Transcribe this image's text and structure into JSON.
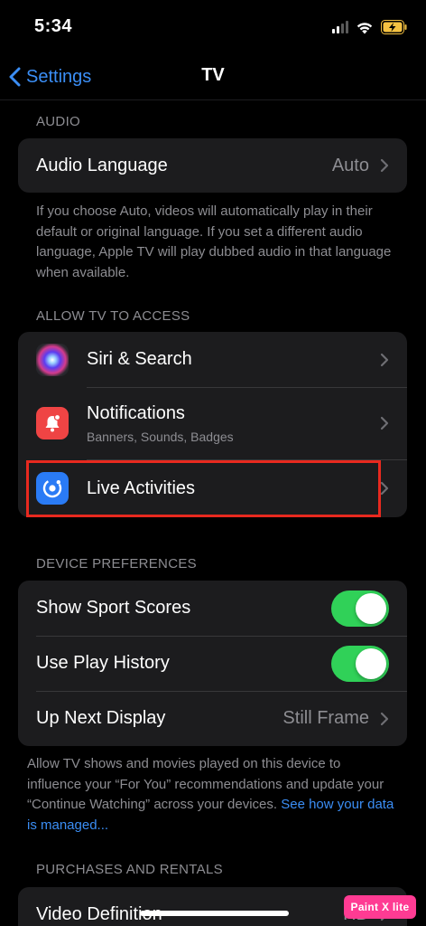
{
  "status_bar": {
    "time": "5:34"
  },
  "nav": {
    "back_label": "Settings",
    "title": "TV"
  },
  "sections": {
    "audio": {
      "header": "AUDIO",
      "rows": [
        {
          "label": "Audio Language",
          "value": "Auto"
        }
      ],
      "footnote": "If you choose Auto, videos will automatically play in their default or original language. If you set a different audio language, Apple TV will play dubbed audio in that language when available."
    },
    "access": {
      "header": "ALLOW TV TO ACCESS",
      "rows": [
        {
          "label": "Siri & Search",
          "icon": "siri-icon"
        },
        {
          "label": "Notifications",
          "sublabel": "Banners, Sounds, Badges",
          "icon": "notification-bell-icon"
        },
        {
          "label": "Live Activities",
          "icon": "live-activities-icon"
        }
      ]
    },
    "device": {
      "header": "DEVICE PREFERENCES",
      "rows": [
        {
          "label": "Show Sport Scores",
          "toggle_on": true
        },
        {
          "label": "Use Play History",
          "toggle_on": true
        },
        {
          "label": "Up Next Display",
          "value": "Still Frame"
        }
      ],
      "footnote_text": "Allow TV shows and movies played on this device to influence your “For You” recommendations and update your “Continue Watching” across your devices.",
      "footnote_link": "See how your data is managed..."
    },
    "purchases": {
      "header": "PURCHASES AND RENTALS",
      "rows": [
        {
          "label": "Video Definition",
          "value": "HD"
        }
      ]
    }
  },
  "colors": {
    "accent": "#3b8ef5",
    "toggle_on": "#30d158",
    "highlight": "#e8291f",
    "cell_bg": "#1c1c1e"
  },
  "watermark": {
    "text": "Paint X lite"
  }
}
